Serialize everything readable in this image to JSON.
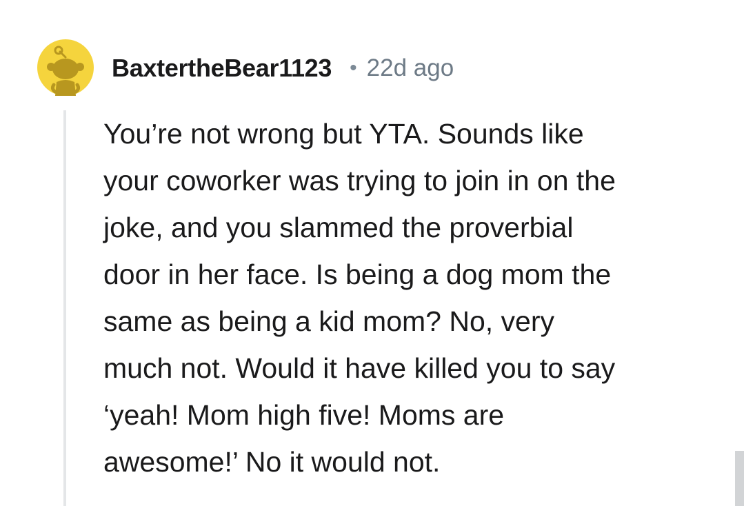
{
  "comment": {
    "author": "BaxtertheBear1123",
    "separator": "•",
    "time_ago": "22d ago",
    "body_lines": [
      "You’re not wrong but YTA. Sounds like",
      "your coworker was trying to join in on the",
      "joke, and you slammed the proverbial",
      "door in her face. Is being a dog mom the",
      "same as being a kid mom? No, very",
      "much not. Would it have killed you to say",
      "‘yeah! Mom high five! Moms are",
      "awesome!’ No it would not."
    ]
  },
  "avatar": {
    "icon": "reddit-snoo-avatar-icon",
    "background_color": "#f5d43d",
    "figure_color": "#b8971f"
  },
  "colors": {
    "text": "#1a1a1b",
    "meta": "#6d7a86",
    "thread_line": "#e4e6e8"
  }
}
